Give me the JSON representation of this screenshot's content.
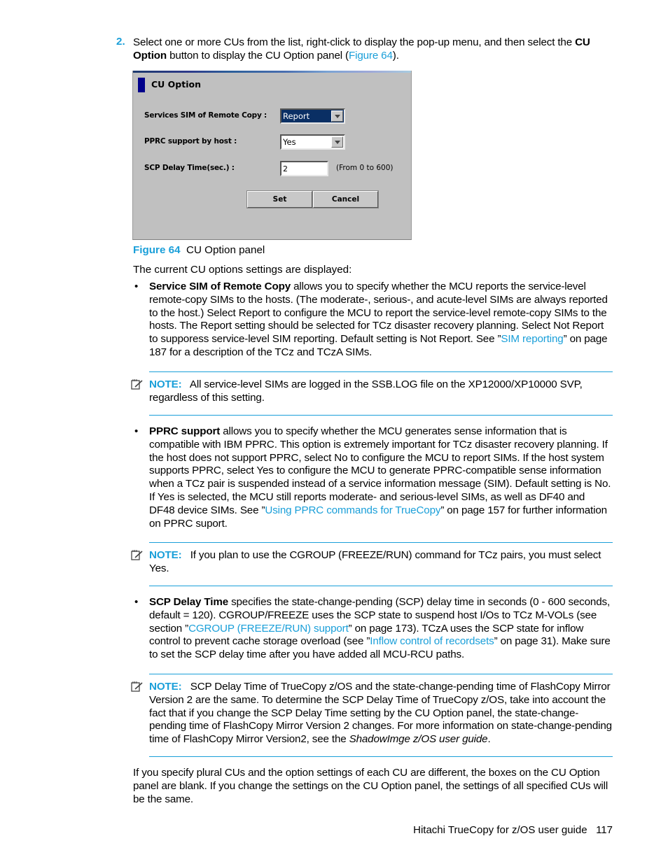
{
  "step": {
    "number": "2.",
    "text_before": "Select one or more CUs from the list, right-click to display the pop-up menu, and then select the ",
    "bold": "CU Option",
    "text_mid": " button to display the CU Option panel (",
    "link": "Figure 64",
    "text_after": ")."
  },
  "panel": {
    "title": "CU Option",
    "fields": [
      {
        "label": "Services SIM of Remote Copy :",
        "type": "combo",
        "value": "Report",
        "selected": true
      },
      {
        "label": "PPRC support by host :",
        "type": "combo",
        "value": "Yes",
        "selected": false
      },
      {
        "label": "SCP Delay Time(sec.) :",
        "type": "text",
        "value": "2",
        "hint": "(From 0 to 600)"
      }
    ],
    "buttons": {
      "set": "Set",
      "cancel": "Cancel"
    }
  },
  "caption": {
    "figure": "Figure 64",
    "text": "CU Option panel"
  },
  "intro": "The current CU options settings are displayed:",
  "bullets": [
    {
      "term": "Service SIM of Remote Copy",
      "text": " allows you to specify whether the MCU reports the service-level remote-copy SIMs to the hosts. (The moderate-, serious-, and acute-level SIMs are always reported to the host.) Select Report to configure the MCU to report the service-level remote-copy SIMs to the hosts. The Report setting should be selected for TCz disaster recovery planning. Select Not Report to supporess service-level SIM reporting. Default setting is Not Report. See ”",
      "link": "SIM reporting",
      "text_after": "” on page 187 for a description of the TCz and TCzA SIMs."
    },
    {
      "term": "PPRC support",
      "text": " allows you to specify whether the MCU generates sense information that is compatible with IBM PPRC. This option is extremely important for TCz disaster recovery planning. If the host does not support PPRC, select No to configure the MCU to report SIMs. If the host system supports PPRC, select Yes to configure the MCU to generate PPRC-compatible sense information when a TCz pair is suspended instead of a service information message (SIM). Default setting is No. If Yes is selected, the MCU still reports moderate- and serious-level SIMs, as well as DF40 and DF48 device SIMs. See ”",
      "link": "Using PPRC commands for TrueCopy",
      "text_after": "” on page 157 for further information on PPRC suport."
    },
    {
      "term": "SCP Delay Time",
      "text": " specifies the state-change-pending (SCP) delay time in seconds (0 - 600 seconds, default = 120). CGROUP/FREEZE uses the SCP state to suspend host I/Os to TCz M-VOLs (see section ”",
      "link": "CGROUP (FREEZE/RUN) support",
      "text_mid": "” on page 173). TCzA uses the SCP state for inflow control to prevent cache storage overload (see ”",
      "link2": "Inflow control of recordsets",
      "text_after": "” on page 31). Make sure to set the SCP delay time after you have added all MCU-RCU paths."
    }
  ],
  "notes": [
    {
      "label": "NOTE:",
      "text": "All service-level SIMs are logged in the SSB.LOG file on the XP12000/XP10000 SVP, regardless of this setting."
    },
    {
      "label": "NOTE:",
      "text": "If you plan to use the CGROUP (FREEZE/RUN) command for TCz pairs, you must select Yes."
    },
    {
      "label": "NOTE:",
      "text": "SCP Delay Time of TrueCopy z/OS and the state-change-pending time of FlashCopy Mirror Version 2 are the same. To determine the SCP Delay Time of TrueCopy z/OS, take into account the fact that if you change the SCP Delay Time setting by the CU Option panel, the state-change-pending time of FlashCopy Mirror Version 2 changes. For more information on state-change-pending time of FlashCopy Mirror Version2, see the ",
      "italic": "ShadowImge z/OS user guide",
      "text_after": "."
    }
  ],
  "closing": "If you specify plural CUs and the option settings of each CU are different, the boxes on the CU Option panel are blank. If you change the settings on the CU Option panel, the settings of all specified CUs will be the same.",
  "footer": {
    "title": "Hitachi TrueCopy for z/OS user guide",
    "page": "117"
  },
  "colors": {
    "link": "#1a9fd9",
    "panel_bg": "#c0c0c0",
    "selected_combo": "#0a2f64"
  }
}
